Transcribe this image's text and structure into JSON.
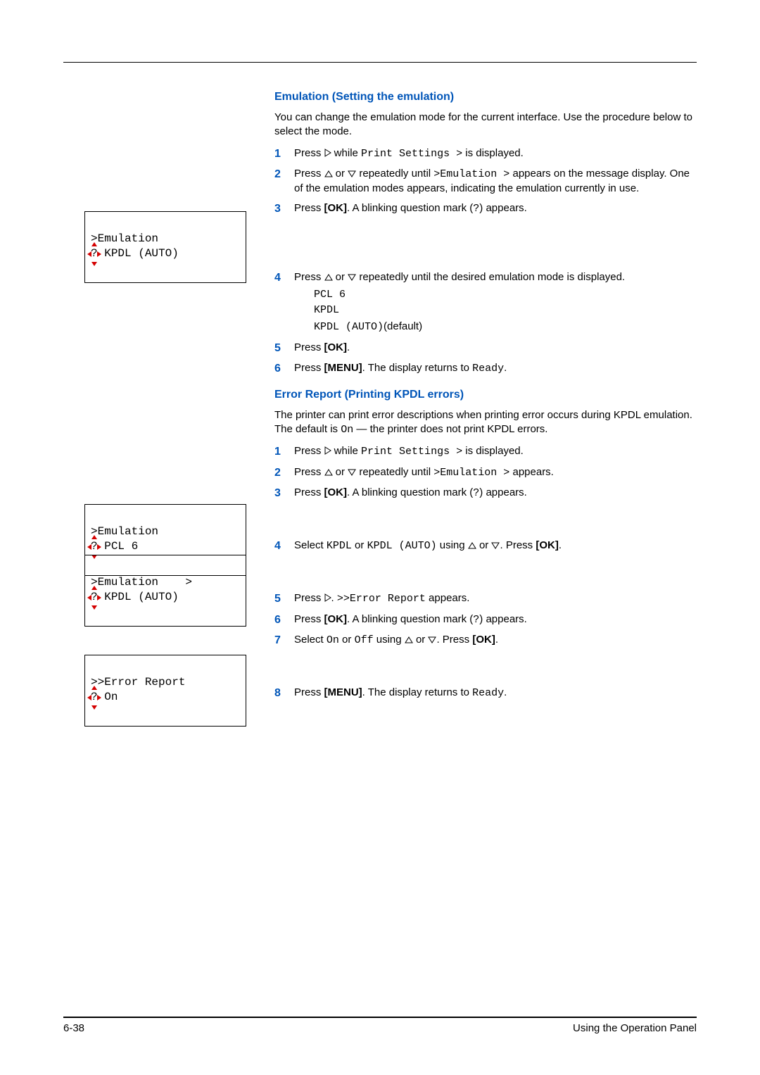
{
  "section1": {
    "title": "Emulation (Setting the emulation)",
    "intro": "You can change the emulation mode for the current interface. Use the procedure below to select the mode.",
    "steps": {
      "s1a": "Press ",
      "s1b": " while ",
      "s1c": "Print Settings >",
      "s1d": " is displayed.",
      "s2a": "Press ",
      "s2b": " or ",
      "s2c": " repeatedly until ",
      "s2d": ">Emulation >",
      "s2e": " appears on the message display. One of the emulation modes appears, indicating the emulation currently in use.",
      "s3a": "Press ",
      "s3b": "[OK]",
      "s3c": ". A blinking question mark (",
      "s3d": "?",
      "s3e": ") appears.",
      "s4a": "Press ",
      "s4b": " or ",
      "s4c": " repeatedly until the desired emulation mode is displayed.",
      "emu1": "PCL 6",
      "emu2": "KPDL",
      "emu3a": "KPDL (AUTO)",
      "emu3b": "(default)",
      "s5a": "Press ",
      "s5b": "[OK]",
      "s5c": ".",
      "s6a": "Press ",
      "s6b": "[MENU]",
      "s6c": ". The display returns to ",
      "s6d": "Ready",
      "s6e": "."
    }
  },
  "section2": {
    "title": "Error Report (Printing KPDL errors)",
    "intro_a": "The printer can print error descriptions when printing error occurs during KPDL emulation. The default is ",
    "intro_b": "On",
    "intro_c": " — the printer does not print KPDL errors.",
    "steps": {
      "s1a": "Press ",
      "s1b": " while ",
      "s1c": "Print Settings >",
      "s1d": " is displayed.",
      "s2a": "Press ",
      "s2b": " or ",
      "s2c": " repeatedly until ",
      "s2d": ">Emulation >",
      "s2e": " appears.",
      "s3a": "Press ",
      "s3b": "[OK]",
      "s3c": ". A blinking question mark (",
      "s3d": "?",
      "s3e": ") appears.",
      "s4a": "Select ",
      "s4b": "KPDL",
      "s4c": " or ",
      "s4d": "KPDL (AUTO)",
      "s4e": " using ",
      "s4f": " or ",
      "s4g": ". Press ",
      "s4h": "[OK]",
      "s4i": ".",
      "s5a": "Press ",
      "s5b": ". ",
      "s5c": ">>Error Report",
      "s5d": " appears.",
      "s6a": "Press ",
      "s6b": "[OK]",
      "s6c": ". A blinking question mark (",
      "s6d": "?",
      "s6e": ") appears.",
      "s7a": "Select ",
      "s7b": "On",
      "s7c": " or ",
      "s7d": "Off",
      "s7e": " using ",
      "s7f": " or ",
      "s7g": ". Press ",
      "s7h": "[OK]",
      "s7i": ".",
      "s8a": "Press ",
      "s8b": "[MENU]",
      "s8c": ". The display returns to ",
      "s8d": "Ready",
      "s8e": "."
    }
  },
  "displays": {
    "d1_l1": ">Emulation",
    "d1_l2a": "?",
    "d1_l2b": " KPDL (AUTO)",
    "d2_l1": ">Emulation",
    "d2_l2a": "?",
    "d2_l2b": " PCL 6",
    "d3_l1": ">Emulation    >",
    "d3_l2a": "?",
    "d3_l2b": " KPDL (AUTO)",
    "d4_l1": ">>Error Report",
    "d4_l2a": "?",
    "d4_l2b": " On"
  },
  "footer": {
    "page": "6-38",
    "title": "Using the Operation Panel"
  },
  "nums": {
    "n1": "1",
    "n2": "2",
    "n3": "3",
    "n4": "4",
    "n5": "5",
    "n6": "6",
    "n7": "7",
    "n8": "8"
  }
}
